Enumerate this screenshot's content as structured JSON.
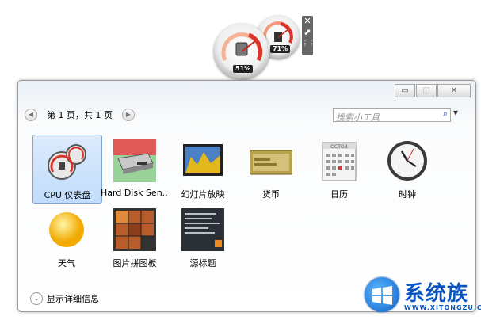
{
  "gadget": {
    "cpu_percent": "51%",
    "memory_percent": "71%",
    "close_glyph": "✕",
    "resize_glyph": "⬈",
    "drag_glyph": "⋮⋮"
  },
  "window": {
    "caption": {
      "minimize": "▭",
      "maximize": "□",
      "close": "✕"
    },
    "pager": {
      "text": "第 1 页，共 1 页",
      "prev": "◀",
      "next": "▶"
    },
    "search": {
      "placeholder": "搜索小工具",
      "icon": "search-icon",
      "dropdown": "▼"
    },
    "gadgets": [
      {
        "label": "CPU 仪表盘",
        "icon": "cpu-meter-icon",
        "selected": true
      },
      {
        "label": "Hard Disk Sen...",
        "icon": "hard-disk-icon",
        "selected": false
      },
      {
        "label": "幻灯片放映",
        "icon": "slideshow-icon",
        "selected": false
      },
      {
        "label": "货币",
        "icon": "currency-icon",
        "selected": false
      },
      {
        "label": "日历",
        "icon": "calendar-icon",
        "selected": false
      },
      {
        "label": "时钟",
        "icon": "clock-icon",
        "selected": false
      },
      {
        "label": "天气",
        "icon": "weather-icon",
        "selected": false
      },
      {
        "label": "图片拼图板",
        "icon": "puzzle-icon",
        "selected": false
      },
      {
        "label": "源标题",
        "icon": "feed-headlines-icon",
        "selected": false
      }
    ],
    "calendar_month": "OCTOB",
    "footer": {
      "label": "显示详细信息",
      "chevron": "⌄"
    }
  },
  "watermark": {
    "title": "系统族",
    "subtitle": "WWW.XITONGZU.COM"
  },
  "colors": {
    "accent_arrow": "#e03030",
    "selected_bg": "#c9e0fb",
    "watermark": "#0a56c2"
  }
}
